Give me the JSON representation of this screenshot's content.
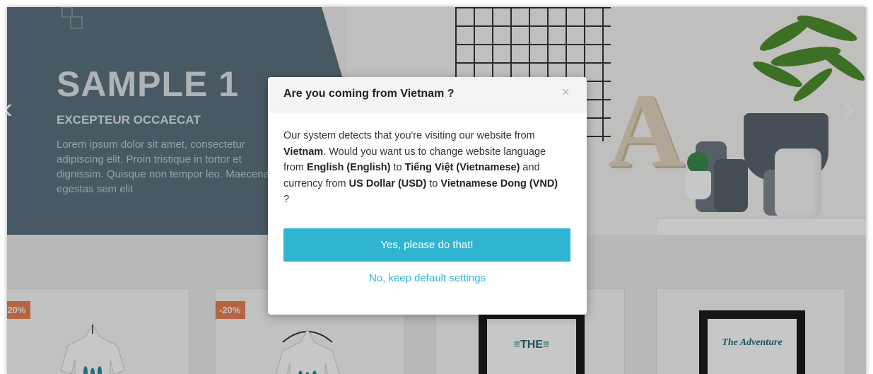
{
  "hero": {
    "title": "SAMPLE 1",
    "subtitle": "EXCEPTEUR OCCAECAT",
    "text": "Lorem ipsum dolor sit amet, consectetur adipiscing elit. Proin tristique in tortor et dignissim. Quisque non tempor leo. Maecenas egestas sem elit",
    "prev_arrow": "‹",
    "next_arrow": "›",
    "panel_color": "#5b727f"
  },
  "products": {
    "cards": [
      {
        "badge": "-20%"
      },
      {
        "badge": "-20%"
      },
      {
        "art_text": "≡THE≡"
      },
      {
        "art_text": "The Adventure"
      }
    ],
    "badge_color": "#ea7f54"
  },
  "modal": {
    "title": "Are you coming from Vietnam ?",
    "close_icon": "×",
    "body": {
      "p1": "Our system detects that you're visiting our website from ",
      "country": "Vietnam",
      "p2": ". Would you want us to change website language from ",
      "lang_from": "English (English)",
      "p3": " to ",
      "lang_to": "Tiếng Việt (Vietnamese)",
      "p4": " and currency from ",
      "cur_from": "US Dollar (USD)",
      "p5": " to ",
      "cur_to": "Vietnamese Dong (VND)",
      "p6": " ?"
    },
    "confirm_label": "Yes, please do that!",
    "decline_label": "No, keep default settings",
    "accent_color": "#2fb5d2"
  }
}
